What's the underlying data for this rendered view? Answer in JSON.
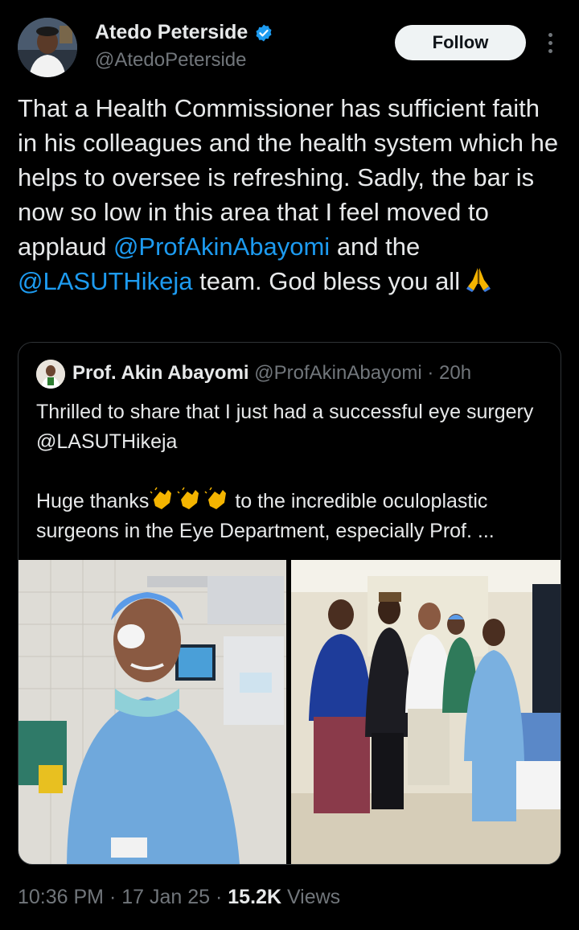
{
  "author": {
    "name": "Atedo Peterside",
    "handle": "@AtedoPeterside",
    "verified_icon": "verified-badge-icon",
    "verified_color": "#1d9bf0"
  },
  "follow_label": "Follow",
  "more_icon": "more-options-icon",
  "tweet": {
    "part1": "That a Health Commissioner has sufficient faith in his colleagues and the health system which he helps to oversee is refreshing. Sadly, the bar is now so low in this area that I feel moved to applaud ",
    "mention1": "@ProfAkinAbayomi",
    "part2": " and the ",
    "mention2": "@LASUTHikeja",
    "part3": " team. God bless you all",
    "emoji_icon": "folded-hands-icon"
  },
  "quote": {
    "name": "Prof. Akin Abayomi",
    "handle": "@ProfAkinAbayomi",
    "separator": " · ",
    "time": "20h",
    "line1": "Thrilled to share that I just had a successful eye surgery @LASUTHikeja",
    "line2_start": "Huge thanks",
    "line2_emoji_icon": "clapping-hands-icon",
    "line2_end": " to the incredible oculoplastic surgeons in the Eye Department, especially Prof. ...",
    "media": [
      {
        "icon": "photo-patient-with-eye-patch"
      },
      {
        "icon": "photo-medical-team-group"
      }
    ]
  },
  "footer": {
    "time": "10:36 PM",
    "sep": " · ",
    "date": "17 Jan 25",
    "views_count": "15.2K",
    "views_label": " Views"
  },
  "colors": {
    "background": "#000000",
    "text": "#e7e9ea",
    "secondary": "#71767b",
    "accent": "#1d9bf0",
    "border": "#2f3336"
  }
}
